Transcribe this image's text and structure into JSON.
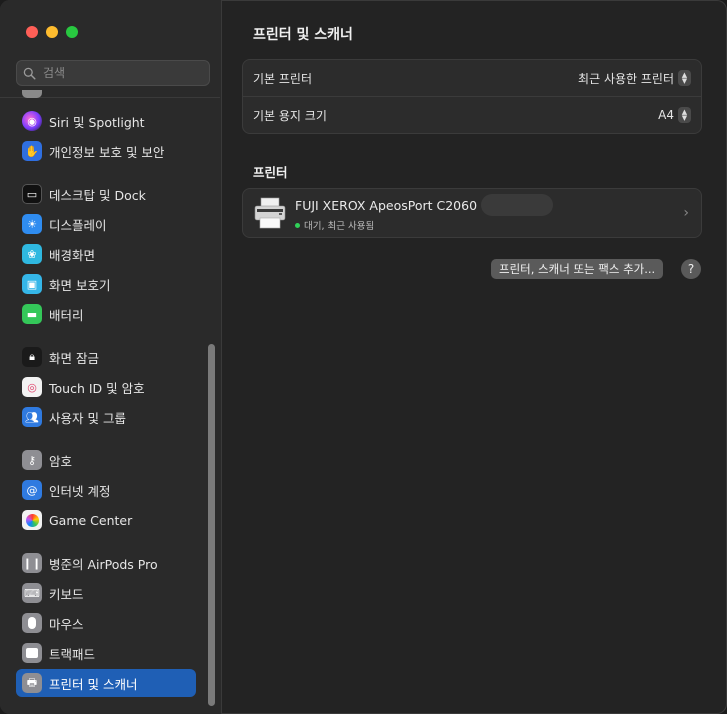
{
  "search": {
    "placeholder": "검색"
  },
  "sidebar": {
    "items": [
      {
        "label": "Siri 및 Spotlight",
        "icon": "siri-icon",
        "color": "#c03bcf"
      },
      {
        "label": "개인정보 보호 및 보안",
        "icon": "hand-icon",
        "color": "#2f6fe0"
      },
      {
        "label": "데스크탑 및 Dock",
        "icon": "dock-icon",
        "color": "#1a1a1a"
      },
      {
        "label": "디스플레이",
        "icon": "display-icon",
        "color": "#2f8cf0"
      },
      {
        "label": "배경화면",
        "icon": "wallpaper-icon",
        "color": "#2fb8e0"
      },
      {
        "label": "화면 보호기",
        "icon": "screensaver-icon",
        "color": "#35b6e8"
      },
      {
        "label": "배터리",
        "icon": "battery-icon",
        "color": "#34c759"
      },
      {
        "label": "화면 잠금",
        "icon": "lock-icon",
        "color": "#1a1a1a"
      },
      {
        "label": "Touch ID 및 암호",
        "icon": "fingerprint-icon",
        "color": "#f2f2f2"
      },
      {
        "label": "사용자 및 그룹",
        "icon": "users-icon",
        "color": "#2f7ae0"
      },
      {
        "label": "암호",
        "icon": "key-icon",
        "color": "#8e8e93"
      },
      {
        "label": "인터넷 계정",
        "icon": "at-icon",
        "color": "#2f7ae0"
      },
      {
        "label": "Game Center",
        "icon": "game-center-icon",
        "color": "#f2f2f2"
      },
      {
        "label": "병준의 AirPods Pro",
        "icon": "airpods-icon",
        "color": "#8e8e93"
      },
      {
        "label": "키보드",
        "icon": "keyboard-icon",
        "color": "#8e8e93"
      },
      {
        "label": "마우스",
        "icon": "mouse-icon",
        "color": "#8e8e93"
      },
      {
        "label": "트랙패드",
        "icon": "trackpad-icon",
        "color": "#8e8e93"
      },
      {
        "label": "프린터 및 스캐너",
        "icon": "printer-icon",
        "color": "#8e8e93"
      }
    ]
  },
  "main": {
    "title": "프린터 및 스캐너",
    "settings": [
      {
        "label": "기본 프린터",
        "value": "최근 사용한 프린터"
      },
      {
        "label": "기본 용지 크기",
        "value": "A4"
      }
    ],
    "printers_title": "프린터",
    "printer": {
      "name": "FUJI XEROX ApeosPort C2060",
      "status": "대기, 최근 사용됨"
    },
    "add_button": "프린터, 스캐너 또는 팩스 추가...",
    "help_button": "?"
  },
  "colors": {
    "accent": "#1f5fb5",
    "status_green": "#30d158"
  }
}
